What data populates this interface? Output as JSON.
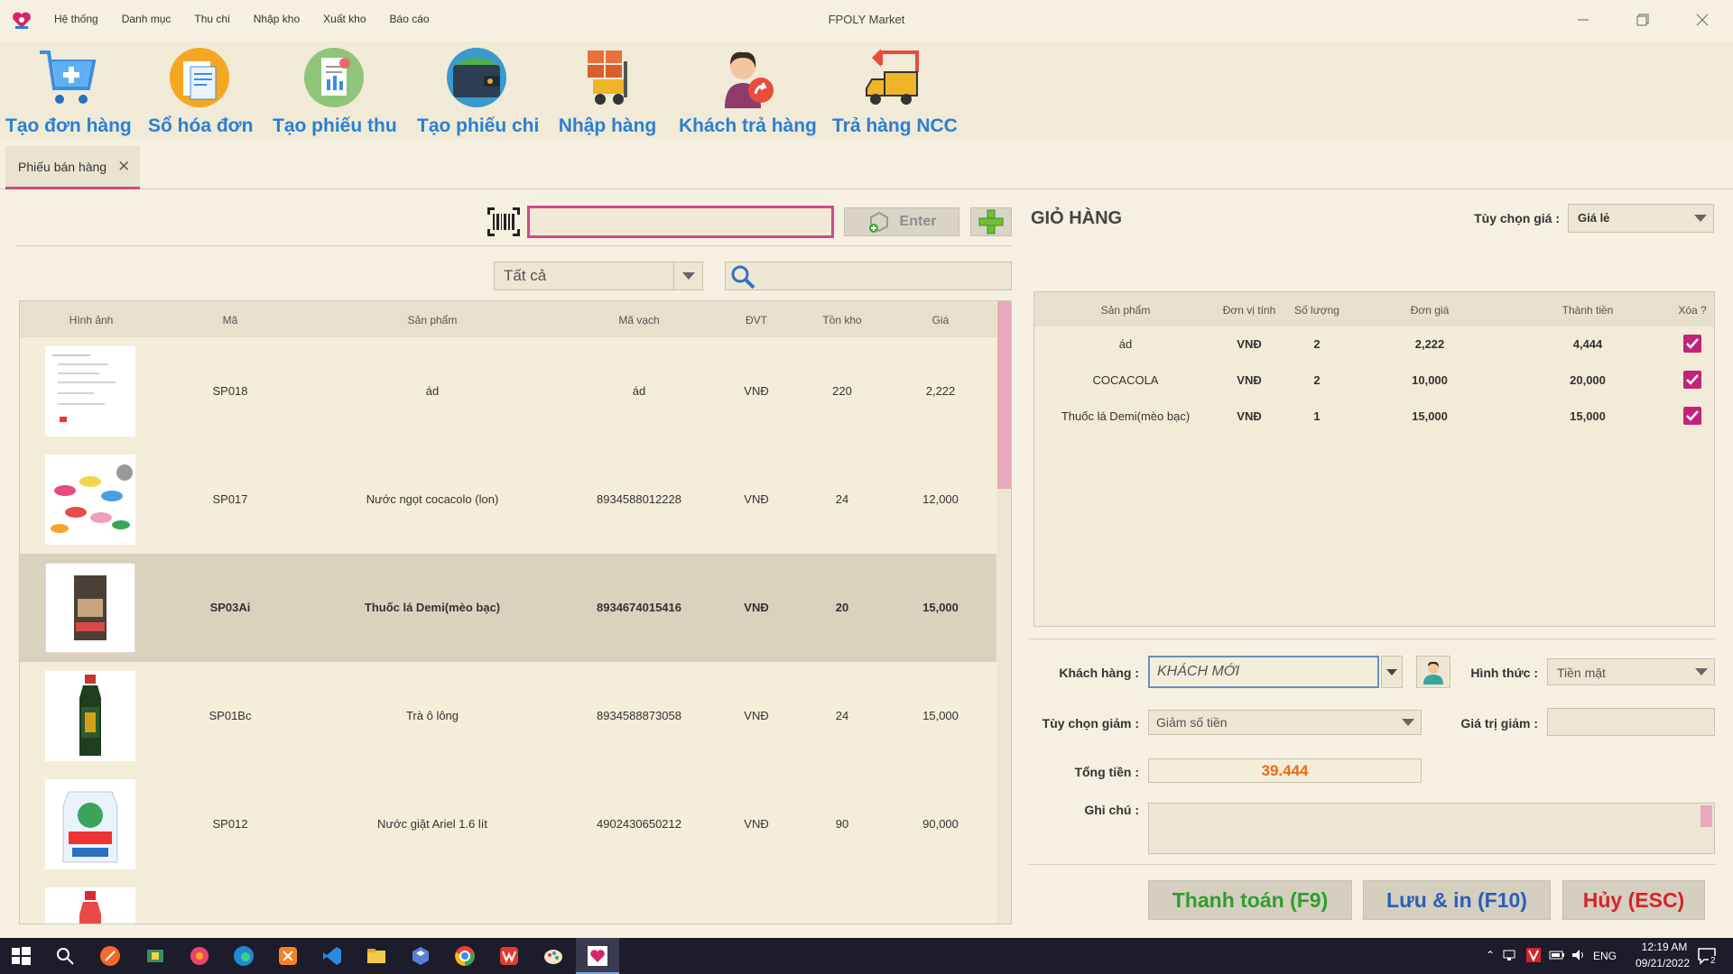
{
  "app": {
    "title": "FPOLY Market"
  },
  "menu": [
    "Hệ thống",
    "Danh mục",
    "Thu chi",
    "Nhập kho",
    "Xuất kho",
    "Báo cáo"
  ],
  "toolbar": [
    {
      "label": "Tạo đơn hàng",
      "icon": "cart-icon"
    },
    {
      "label": "Sổ hóa đơn",
      "icon": "invoice-book-icon"
    },
    {
      "label": "Tạo phiếu thu",
      "icon": "receipt-icon"
    },
    {
      "label": "Tạo phiếu chi",
      "icon": "wallet-icon"
    },
    {
      "label": "Nhập hàng",
      "icon": "forklift-icon"
    },
    {
      "label": "Khách trả hàng",
      "icon": "customer-return-icon"
    },
    {
      "label": "Trả hàng NCC",
      "icon": "truck-return-icon"
    }
  ],
  "tab": {
    "label": "Phiếu bán hàng"
  },
  "scan": {
    "value": "",
    "enter_label": "Enter"
  },
  "filter": {
    "category": "Tất cả",
    "search_value": ""
  },
  "products": {
    "headers": [
      "Hình ảnh",
      "Mã",
      "Sản phẩm",
      "Mã vạch",
      "ĐVT",
      "Tồn kho",
      "Giá"
    ],
    "rows": [
      {
        "code": "SP018",
        "name": "ád",
        "barcode": "ád",
        "unit": "VNĐ",
        "stock": "220",
        "price": "2,222"
      },
      {
        "code": "SP017",
        "name": "Nước ngọt cocacolo (lon)",
        "barcode": "8934588012228",
        "unit": "VNĐ",
        "stock": "24",
        "price": "12,000"
      },
      {
        "code": "SP03Ai",
        "name": "Thuốc lá Demi(mèo bạc)",
        "barcode": "8934674015416",
        "unit": "VNĐ",
        "stock": "20",
        "price": "15,000"
      },
      {
        "code": "SP01Bc",
        "name": "Trà ô lông",
        "barcode": "8934588873058",
        "unit": "VNĐ",
        "stock": "24",
        "price": "15,000"
      },
      {
        "code": "SP012",
        "name": "Nước giặt Ariel 1.6 lít",
        "barcode": "4902430650212",
        "unit": "VNĐ",
        "stock": "90",
        "price": "90,000"
      }
    ]
  },
  "cart": {
    "title": "GIỎ HÀNG",
    "price_option_label": "Tùy chọn giá :",
    "price_option_value": "Giá lẻ",
    "headers": [
      "Sản phẩm",
      "Đơn vị tính",
      "Số lượng",
      "Đơn giá",
      "Thành tiền",
      "Xóa ?"
    ],
    "rows": [
      {
        "name": "ád",
        "unit": "VNĐ",
        "qty": "2",
        "price": "2,222",
        "total": "4,444"
      },
      {
        "name": "COCACOLA",
        "unit": "VNĐ",
        "qty": "2",
        "price": "10,000",
        "total": "20,000"
      },
      {
        "name": "Thuốc lá Demi(mèo bạc)",
        "unit": "VNĐ",
        "qty": "1",
        "price": "15,000",
        "total": "15,000"
      }
    ]
  },
  "form": {
    "customer_label": "Khách hàng :",
    "customer_value": "KHÁCH MỚI",
    "payment_label": "Hình thức :",
    "payment_value": "Tiền mặt",
    "discount_option_label": "Tùy chọn giảm :",
    "discount_option_value": "Giảm số tiền",
    "discount_value_label": "Giá trị giảm :",
    "discount_value": "",
    "total_label": "Tổng tiền :",
    "total_value": "39.444",
    "note_label": "Ghi chú :",
    "note_value": ""
  },
  "actions": {
    "pay": "Thanh toán (F9)",
    "save_print": "Lưu & in (F10)",
    "cancel": "Hủy (ESC)"
  },
  "taskbar": {
    "lang": "ENG",
    "time": "12:19 AM",
    "date": "09/21/2022",
    "notifications": "2"
  },
  "colors": {
    "accent_blue": "#2a7fd4",
    "accent_pink": "#d14a8b",
    "pay_green": "#2f9e2f",
    "save_blue": "#2a5fb8",
    "cancel_red": "#d6232a",
    "total_orange": "#ec6a12"
  }
}
